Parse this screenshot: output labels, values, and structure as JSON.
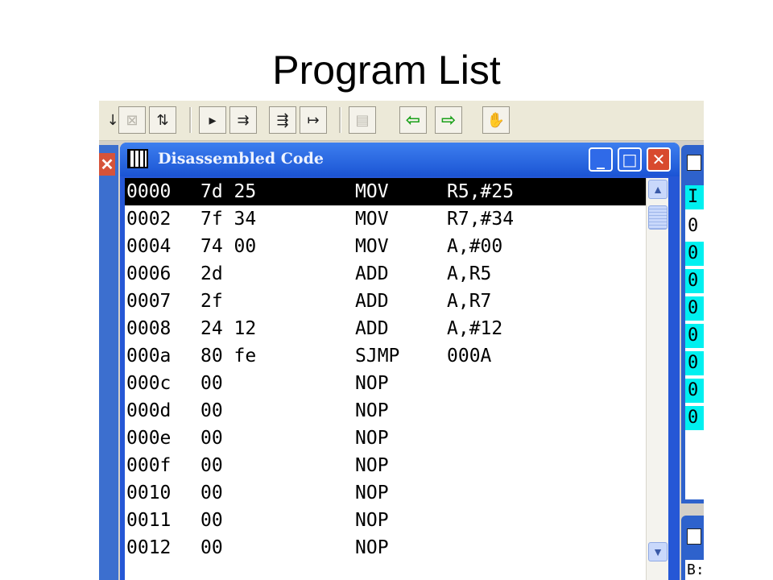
{
  "slide": {
    "title": "Program List"
  },
  "toolbar": {
    "buttons": [
      {
        "name": "step-into-icon",
        "glyph": "↓"
      },
      {
        "name": "disabled-grid-icon",
        "glyph": "⊠"
      },
      {
        "name": "reset-icon",
        "glyph": "⇅"
      },
      {
        "name": "run-icon",
        "glyph": "▸"
      },
      {
        "name": "step-over-icon",
        "glyph": "⇉"
      },
      {
        "name": "step-out-icon",
        "glyph": "⇶"
      },
      {
        "name": "run-to-cursor-icon",
        "glyph": "↦"
      },
      {
        "name": "disabled-page-icon",
        "glyph": "▤"
      },
      {
        "name": "back-arrow-icon",
        "glyph": "⇦"
      },
      {
        "name": "forward-arrow-icon",
        "glyph": "⇨"
      },
      {
        "name": "hand-icon",
        "glyph": "✋"
      }
    ]
  },
  "window": {
    "title": "Disassembled Code",
    "minimize_glyph": "_",
    "maximize_glyph": "□",
    "close_glyph": "✕",
    "lines": [
      {
        "addr": "0000",
        "bytes": "7d 25",
        "mnemonic": "MOV",
        "operands": "R5,#25",
        "selected": true
      },
      {
        "addr": "0002",
        "bytes": "7f 34",
        "mnemonic": "MOV",
        "operands": "R7,#34"
      },
      {
        "addr": "0004",
        "bytes": "74 00",
        "mnemonic": "MOV",
        "operands": "A,#00"
      },
      {
        "addr": "0006",
        "bytes": "2d",
        "mnemonic": "ADD",
        "operands": "A,R5"
      },
      {
        "addr": "0007",
        "bytes": "2f",
        "mnemonic": "ADD",
        "operands": "A,R7"
      },
      {
        "addr": "0008",
        "bytes": "24 12",
        "mnemonic": "ADD",
        "operands": "A,#12"
      },
      {
        "addr": "000a",
        "bytes": "80 fe",
        "mnemonic": "SJMP",
        "operands": "000A"
      },
      {
        "addr": "000c",
        "bytes": "00",
        "mnemonic": "NOP",
        "operands": ""
      },
      {
        "addr": "000d",
        "bytes": "00",
        "mnemonic": "NOP",
        "operands": ""
      },
      {
        "addr": "000e",
        "bytes": "00",
        "mnemonic": "NOP",
        "operands": ""
      },
      {
        "addr": "000f",
        "bytes": "00",
        "mnemonic": "NOP",
        "operands": ""
      },
      {
        "addr": "0010",
        "bytes": "00",
        "mnemonic": "NOP",
        "operands": ""
      },
      {
        "addr": "0011",
        "bytes": "00",
        "mnemonic": "NOP",
        "operands": ""
      },
      {
        "addr": "0012",
        "bytes": "00",
        "mnemonic": "NOP",
        "operands": ""
      }
    ]
  },
  "scrollbar": {
    "up_glyph": "▲",
    "down_glyph": "▼"
  },
  "left_window": {
    "close_glyph": "✕"
  },
  "right_window": {
    "rows": [
      {
        "text": "I",
        "cyan": true
      },
      {
        "text": "0",
        "cyan": false
      },
      {
        "text": "0",
        "cyan": true
      },
      {
        "text": "0",
        "cyan": true
      },
      {
        "text": "0",
        "cyan": true
      },
      {
        "text": "0",
        "cyan": true
      },
      {
        "text": "0",
        "cyan": true
      },
      {
        "text": "0",
        "cyan": true
      },
      {
        "text": "0",
        "cyan": true
      }
    ]
  },
  "right_window2": {
    "text": "B:"
  },
  "colors": {
    "title_bar": "#2557d6",
    "selection": "#000000",
    "cyan_highlight": "#00f0f0",
    "close_button": "#d84a2e"
  }
}
